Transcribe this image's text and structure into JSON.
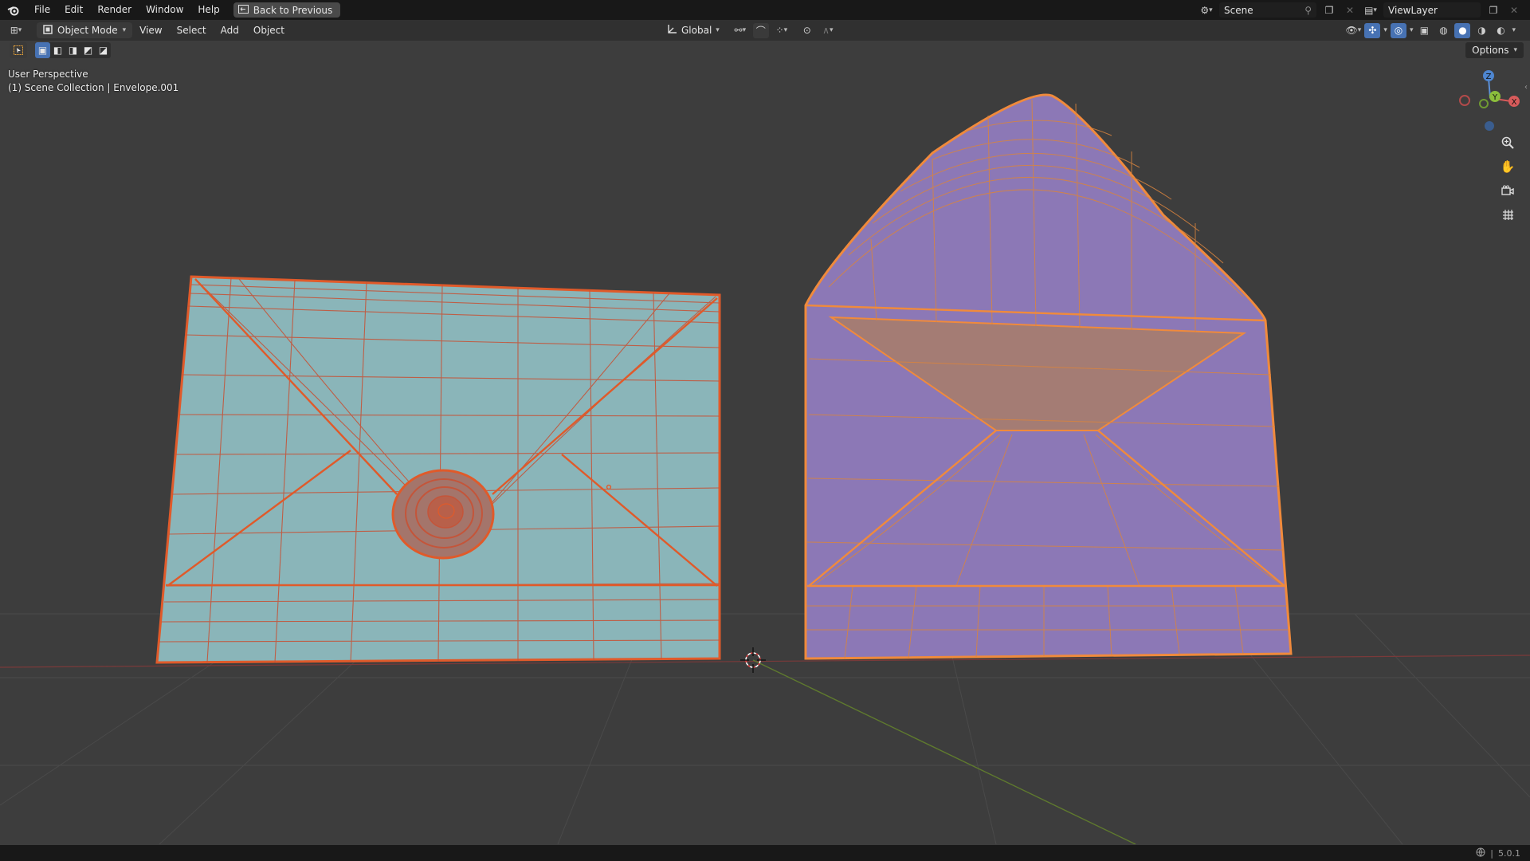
{
  "topbar": {
    "menus": [
      "File",
      "Edit",
      "Render",
      "Window",
      "Help"
    ],
    "back_button": "Back to Previous",
    "scene": "Scene",
    "view_layer": "ViewLayer"
  },
  "header": {
    "mode": "Object Mode",
    "menus": [
      "View",
      "Select",
      "Add",
      "Object"
    ],
    "transform_orientation": "Global",
    "options": "Options"
  },
  "viewport": {
    "perspective": "User Perspective",
    "collection": "(1) Scene Collection | Envelope.001",
    "gizmo_axes": [
      "Z",
      "X",
      "Y"
    ]
  },
  "status": {
    "version": "5.0.1"
  },
  "colors": {
    "viewport_bg": "#3d3d3d",
    "closed_envelope": "#8ab5b9",
    "open_envelope": "#8c78b6",
    "envelope_inner_flap": "#a47c74",
    "wireframe_selected": "#e05a2a",
    "wireframe_active": "#f08a3c",
    "accent": "#4772b3"
  },
  "icons": {
    "blender": "blender-logo-icon",
    "cursor": "3d-cursor-icon",
    "zoom": "zoom-icon",
    "pan": "hand-pan-icon",
    "camera": "camera-icon",
    "grid": "grid-view-icon"
  }
}
